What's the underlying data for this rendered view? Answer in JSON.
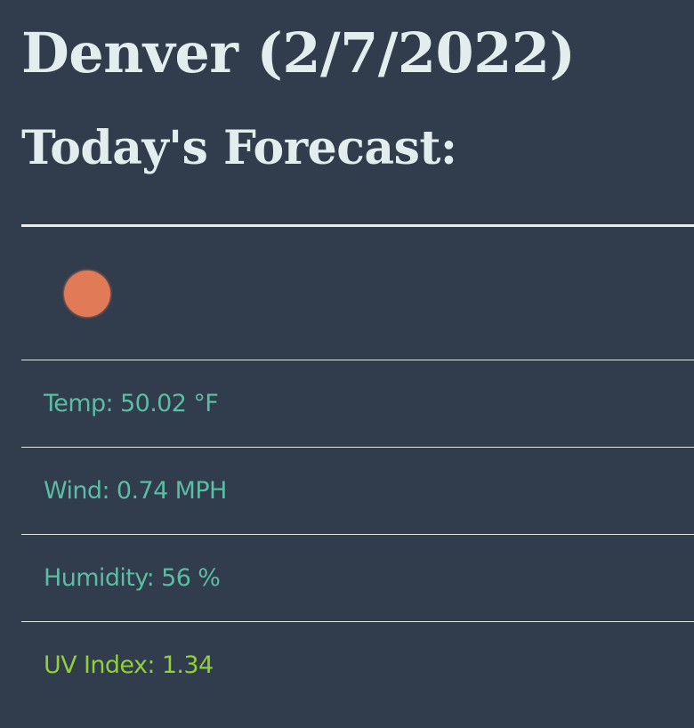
{
  "header": {
    "city_date": "Denver (2/7/2022)",
    "forecast_heading": "Today's Forecast:"
  },
  "icon": {
    "name": "sun-icon",
    "color": "#e07a57"
  },
  "stats": {
    "temp": "Temp: 50.02 °F",
    "wind": "Wind: 0.74 MPH",
    "humidity": "Humidity: 56 %",
    "uv_index": "UV Index: 1.34"
  },
  "colors": {
    "background": "#313c4c",
    "heading": "#e2eeee",
    "stat_text": "#5bbda3",
    "uv_low": "#8fcf3a"
  }
}
